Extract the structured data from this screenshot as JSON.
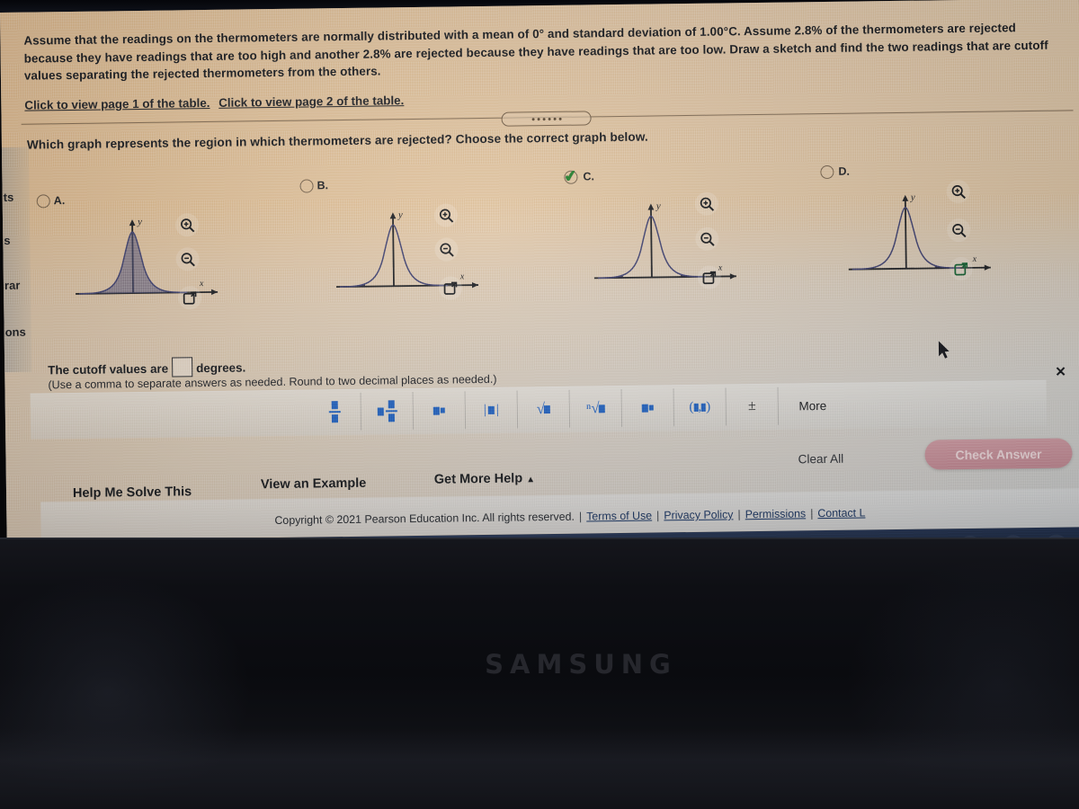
{
  "question": {
    "body": "Assume that the readings on the thermometers are normally distributed with a mean of 0° and standard deviation of 1.00°C. Assume 2.8% of the thermometers are rejected because they have readings that are too high and another 2.8% are rejected because they have readings that are too low. Draw a sketch and find the two readings that are cutoff values separating the rejected thermometers from the others.",
    "table_link_1": "Click to view page 1 of the table.",
    "table_link_2": "Click to view page 2 of the table.",
    "prompt": "Which graph represents the region in which thermometers are rejected? Choose the correct graph below."
  },
  "options": [
    {
      "letter": "A.",
      "selected": false,
      "shading": "center",
      "x_label": "x",
      "y_label": "y"
    },
    {
      "letter": "B.",
      "selected": false,
      "shading": "left-tail",
      "x_label": "x",
      "y_label": "y"
    },
    {
      "letter": "C.",
      "selected": true,
      "shading": "both-tails",
      "x_label": "x",
      "y_label": "y"
    },
    {
      "letter": "D.",
      "selected": false,
      "shading": "right-tail",
      "x_label": "x",
      "y_label": "y"
    }
  ],
  "graph_tools": {
    "zoom_in": "zoom-in-icon",
    "zoom_out": "zoom-out-icon",
    "popout": "open-in-new-window-icon"
  },
  "answer": {
    "prefix": "The cutoff values are",
    "suffix": "degrees.",
    "value": "",
    "hint": "(Use a comma to separate answers as needed. Round to two decimal places as needed.)"
  },
  "math_toolbar": {
    "buttons": [
      {
        "name": "fraction",
        "glyph": "frac"
      },
      {
        "name": "mixed-number",
        "glyph": "mixed"
      },
      {
        "name": "exponent",
        "glyph": "exp"
      },
      {
        "name": "absolute-value",
        "glyph": "abs"
      },
      {
        "name": "square-root",
        "glyph": "sqrt"
      },
      {
        "name": "nth-root",
        "glyph": "nroot"
      },
      {
        "name": "subscript",
        "glyph": "sub"
      },
      {
        "name": "interval",
        "glyph": "paren"
      },
      {
        "name": "plus-minus",
        "glyph": "pm"
      }
    ],
    "more_label": "More"
  },
  "actions": {
    "help_me_solve_this": "Help Me Solve This",
    "view_an_example": "View an Example",
    "get_more_help": "Get More Help",
    "clear_all": "Clear All",
    "check_answer": "Check Answer",
    "close": "✕"
  },
  "footer": {
    "copyright": "Copyright © 2021 Pearson Education Inc. All rights reserved.",
    "links": [
      "Terms of Use",
      "Privacy Policy",
      "Permissions",
      "Contact L"
    ]
  },
  "sidebar_fragments": [
    "ts",
    "s",
    "rar",
    "ons"
  ],
  "monitor": {
    "brand": "SAMSUNG"
  },
  "taskbar": {
    "icons": [
      {
        "name": "chrome-icon",
        "color": "#f2f3f4"
      },
      {
        "name": "gmail-icon",
        "color": "#f4f4f4"
      },
      {
        "name": "docs-icon",
        "color": "#f4f4f4"
      },
      {
        "name": "youtube-icon",
        "color": "#f4f4f4"
      },
      {
        "name": "sheets-icon",
        "color": "#1f7a4d"
      },
      {
        "name": "video-app-icon",
        "color": "#1a73c8"
      }
    ],
    "right_icons": [
      {
        "name": "multi-window-icon"
      },
      {
        "name": "tablet-icon"
      },
      {
        "name": "system-indicator-icon"
      }
    ]
  },
  "colors": {
    "accent_blue": "#1f5fbf",
    "check_green": "#1d7a28",
    "link_blue": "#16305c",
    "check_answer_pink": "#c48490",
    "taskbar": "#1b2840"
  }
}
